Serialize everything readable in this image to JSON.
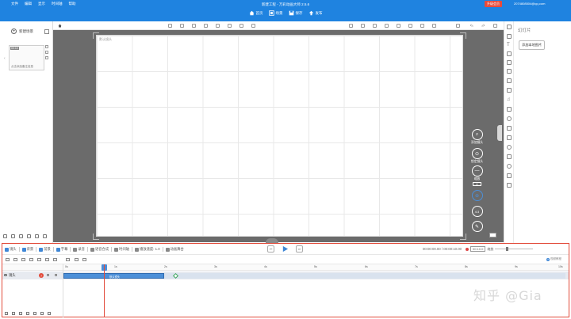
{
  "window": {
    "title": "新建工程 - 万彩动画大师 2.5.6",
    "menu": [
      "文件",
      "编辑",
      "显示",
      "时间轴",
      "帮助"
    ],
    "vip_label": "升级会员",
    "user_email": "2074808504@qq.com"
  },
  "main_toolbar": [
    {
      "label": "首页",
      "icon": "home-icon"
    },
    {
      "label": "场景",
      "icon": "scene-icon"
    },
    {
      "label": "保存",
      "icon": "save-icon"
    },
    {
      "label": "发布",
      "icon": "publish-icon"
    }
  ],
  "scene_panel": {
    "new_scene_label": "新建场景",
    "thumb_tag": "00:10",
    "thumb_caption": "点击添加备注信息"
  },
  "canvas": {
    "camera_label": "默认镜头"
  },
  "side_tools": {
    "camera_label": "镜头",
    "add_camera_label": "添加镜头",
    "lock_label": "锁定镜头",
    "zoom_label": "缩放",
    "zoom_value": "4"
  },
  "right_panel": {
    "title": "幻灯片",
    "add_button": "添加本地图片"
  },
  "timeline": {
    "tabs": [
      {
        "label": "镜头"
      },
      {
        "label": "背景"
      },
      {
        "label": "前景"
      },
      {
        "label": "字幕"
      },
      {
        "label": "录音"
      },
      {
        "label": "语音合成"
      },
      {
        "label": "时间轴"
      },
      {
        "label": "播放速度: 1.0"
      },
      {
        "label": "动画舞台"
      }
    ],
    "time_display": "00:00:00.00 / 00:00:10.00",
    "zoom_value": "00:10.0",
    "zoom_unit": "缩放",
    "help_label": "视频教程",
    "ruler_ticks": [
      "0s",
      "1s",
      "2s",
      "3s",
      "4s",
      "5s",
      "6s",
      "7s",
      "8s",
      "9s",
      "10s"
    ],
    "layer": {
      "name": "镜头",
      "clip_label": "默认镜头"
    }
  },
  "watermark": "知乎 @Gia"
}
